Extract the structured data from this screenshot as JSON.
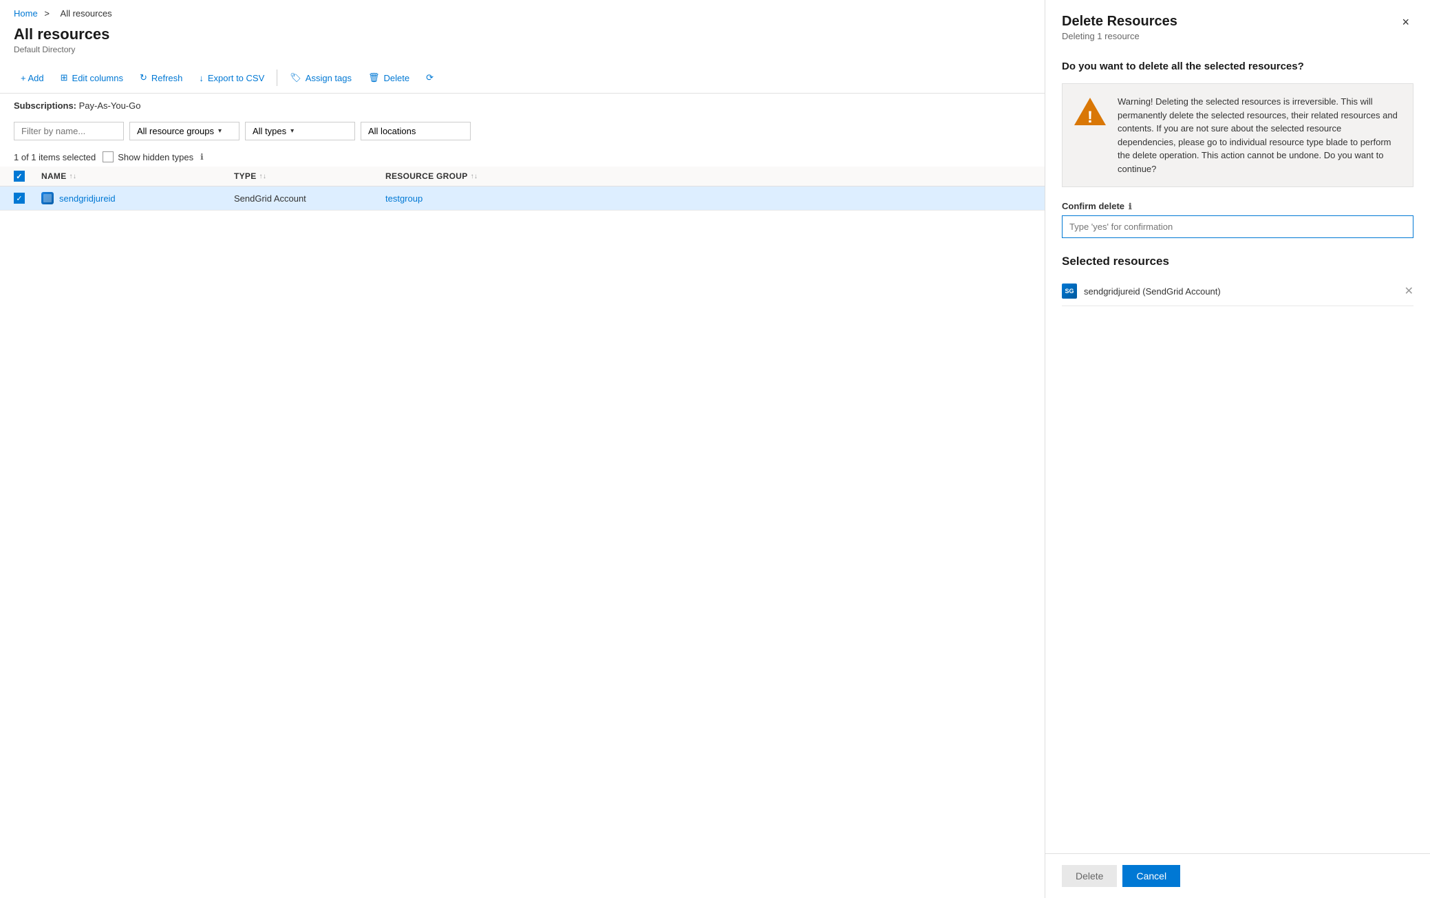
{
  "breadcrumb": {
    "home": "Home",
    "separator": ">",
    "current": "All resources"
  },
  "page": {
    "title": "All resources",
    "subtitle": "Default Directory"
  },
  "toolbar": {
    "add_label": "+ Add",
    "edit_columns_label": "Edit columns",
    "refresh_label": "Refresh",
    "export_csv_label": "Export to CSV",
    "assign_tags_label": "Assign tags",
    "delete_label": "Delete"
  },
  "subscriptions": {
    "label": "Subscriptions:",
    "value": "Pay-As-You-Go"
  },
  "filters": {
    "name_placeholder": "Filter by name...",
    "resource_group_label": "All resource groups",
    "type_label": "All types",
    "location_label": "All locations"
  },
  "selection_bar": {
    "count": "1 of 1 items selected",
    "show_hidden": "Show hidden types"
  },
  "table": {
    "columns": [
      "NAME",
      "TYPE",
      "RESOURCE GROUP"
    ],
    "rows": [
      {
        "name": "sendgridjureid",
        "type": "SendGrid Account",
        "resource_group": "testgroup",
        "checked": true
      }
    ]
  },
  "delete_panel": {
    "title": "Delete Resources",
    "subtitle": "Deleting 1 resource",
    "close_label": "×",
    "confirm_question": "Do you want to delete all the selected resources?",
    "warning_text": "Warning! Deleting the selected resources is irreversible. This will permanently delete the selected resources, their related resources and contents. If you are not sure about the selected resource dependencies, please go to individual resource type blade to perform the delete operation. This action cannot be undone. Do you want to continue?",
    "confirm_label": "Confirm delete",
    "confirm_placeholder": "Type 'yes' for confirmation",
    "selected_resources_title": "Selected resources",
    "resources": [
      {
        "name": "sendgridjureid (SendGrid Account)"
      }
    ],
    "delete_button": "Delete",
    "cancel_button": "Cancel"
  }
}
